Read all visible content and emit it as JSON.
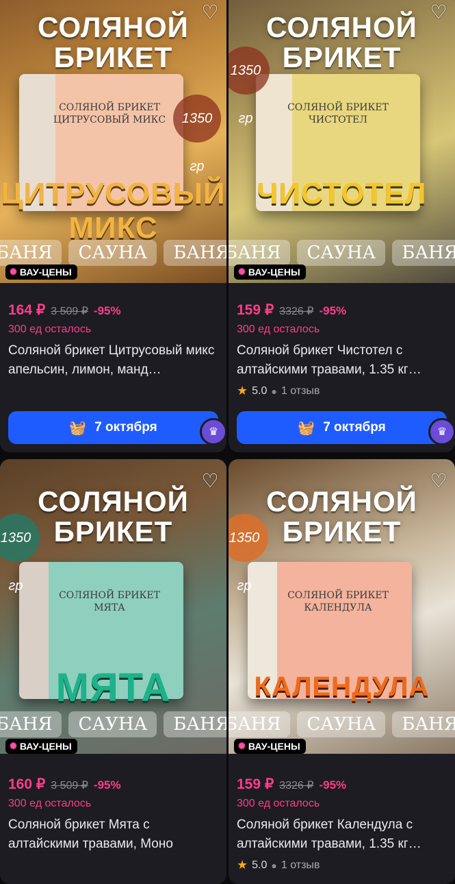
{
  "cards": [
    {
      "header": "СОЛЯНОЙ\nБРИКЕТ",
      "brick_label": "СОЛЯНОЙ БРИКЕТ ЦИТРУСОВЫЙ МИКС",
      "weight": "1350 гр",
      "big_name": "ЦИТРУСОВЫЙ МИКС",
      "tags": [
        "БАНЯ",
        "САУНА",
        "БАНЯ"
      ],
      "badge": "ВАУ-ЦЕНЫ",
      "price": "164 ₽",
      "old_price": "3 509 ₽",
      "discount": "-95%",
      "left": "300 ед осталось",
      "title": "Соляной брикет Цитрусовый микс апельсин, лимон, манд…",
      "rating": "",
      "reviews": "",
      "delivery": "7 октября"
    },
    {
      "header": "СОЛЯНОЙ\nБРИКЕТ",
      "brick_label": "СОЛЯНОЙ БРИКЕТ ЧИСТОТЕЛ",
      "weight": "1350 гр",
      "big_name": "ЧИСТОТЕЛ",
      "tags": [
        "БАНЯ",
        "САУНА",
        "БАНЯ"
      ],
      "badge": "ВАУ-ЦЕНЫ",
      "price": "159 ₽",
      "old_price": "3326 ₽",
      "discount": "-95%",
      "left": "300 ед осталось",
      "title": "Соляной брикет Чистотел с алтайскими травами, 1.35 кг…",
      "rating": "5.0",
      "reviews": "1 отзыв",
      "delivery": "7 октября"
    },
    {
      "header": "СОЛЯНОЙ\nБРИКЕТ",
      "brick_label": "СОЛЯНОЙ БРИКЕТ МЯТА",
      "weight": "1350 гр",
      "big_name": "МЯТА",
      "tags": [
        "БАНЯ",
        "САУНА",
        "БАНЯ"
      ],
      "badge": "ВАУ-ЦЕНЫ",
      "price": "160 ₽",
      "old_price": "3 509 ₽",
      "discount": "-95%",
      "left": "300 ед осталось",
      "title": "Соляной брикет Мята с алтайскими травами, Моно",
      "rating": "",
      "reviews": "",
      "delivery": ""
    },
    {
      "header": "СОЛЯНОЙ\nБРИКЕТ",
      "brick_label": "СОЛЯНОЙ БРИКЕТ КАЛЕНДУЛА",
      "weight": "1350 гр",
      "big_name": "КАЛЕНДУЛА",
      "tags": [
        "БАНЯ",
        "САУНА",
        "БАНЯ"
      ],
      "badge": "ВАУ-ЦЕНЫ",
      "price": "159 ₽",
      "old_price": "3326 ₽",
      "discount": "-95%",
      "left": "300 ед осталось",
      "title": "Соляной брикет Календула с алтайскими травами, 1.35 кг…",
      "rating": "5.0",
      "reviews": "1 отзыв",
      "delivery": ""
    }
  ],
  "icons": {
    "heart": "heart-icon",
    "basket": "basket-icon",
    "star": "star-icon",
    "comment": "comment-icon",
    "crown": "crown-icon",
    "flash": "flash-icon"
  },
  "colors": {
    "accent_pink": "#ff3d8a",
    "button_blue": "#1f5cff",
    "card_bg": "#1c1c22",
    "star": "#ffa61a"
  }
}
